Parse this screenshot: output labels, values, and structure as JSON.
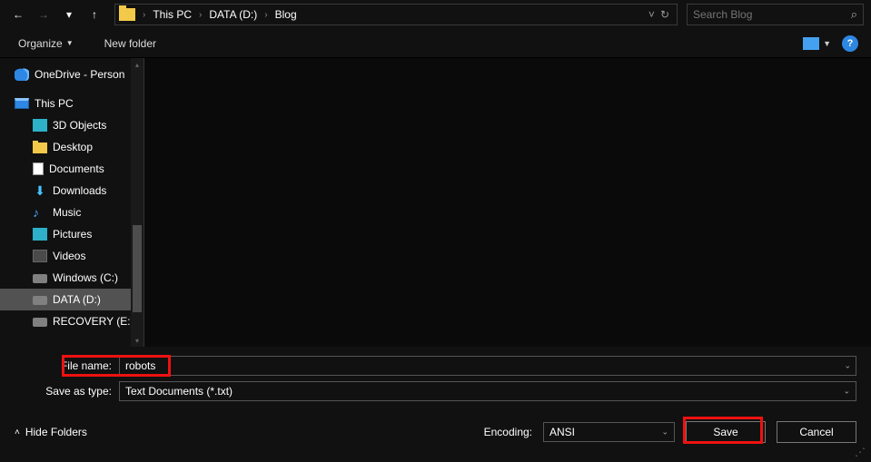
{
  "nav": {
    "back": "←",
    "fwd": "→",
    "recent": "▾",
    "up": "↑"
  },
  "breadcrumb": {
    "sep": "›",
    "items": [
      "This PC",
      "DATA (D:)",
      "Blog"
    ],
    "dropdown": "˅",
    "refresh": "↻"
  },
  "search": {
    "placeholder": "Search Blog"
  },
  "toolbar": {
    "organize": "Organize",
    "organize_chev": "▼",
    "newfolder": "New folder"
  },
  "help": "?",
  "tree": {
    "onedrive": "OneDrive - Person",
    "thispc": "This PC",
    "items": [
      {
        "label": "3D Objects"
      },
      {
        "label": "Desktop"
      },
      {
        "label": "Documents"
      },
      {
        "label": "Downloads"
      },
      {
        "label": "Music"
      },
      {
        "label": "Pictures"
      },
      {
        "label": "Videos"
      },
      {
        "label": "Windows (C:)"
      },
      {
        "label": "DATA (D:)"
      },
      {
        "label": "RECOVERY (E:)"
      }
    ]
  },
  "form": {
    "filename_label": "File name:",
    "filename_value": "robots",
    "saveas_label": "Save as type:",
    "saveas_value": "Text Documents (*.txt)"
  },
  "footer": {
    "hide_folders": "Hide Folders",
    "encoding_label": "Encoding:",
    "encoding_value": "ANSI",
    "save": "Save",
    "cancel": "Cancel"
  }
}
